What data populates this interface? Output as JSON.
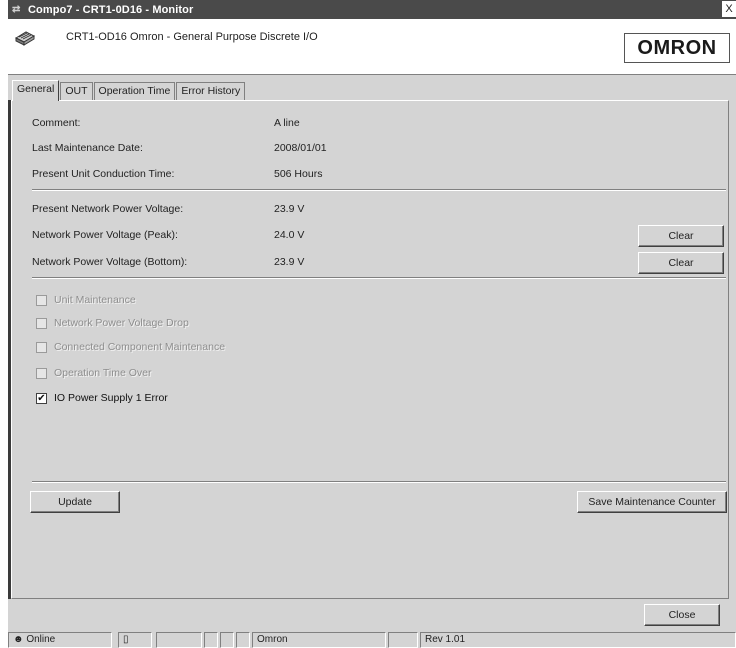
{
  "window": {
    "title": "Compo7 - CRT1-0D16 - Monitor",
    "close_glyph": "X"
  },
  "header": {
    "device_title": "CRT1-OD16   Omron - General Purpose Discrete I/O",
    "logo_text": "OMRON"
  },
  "tabs": [
    {
      "label": "General",
      "active": true
    },
    {
      "label": "OUT",
      "active": false
    },
    {
      "label": "Operation Time",
      "active": false
    },
    {
      "label": "Error History",
      "active": false
    }
  ],
  "general": {
    "comment_label": "Comment:",
    "comment_value": "A line",
    "last_maint_label": "Last Maintenance Date:",
    "last_maint_value": "2008/01/01",
    "conduction_label": "Present Unit Conduction Time:",
    "conduction_value": "506 Hours",
    "voltage_label": "Present Network Power Voltage:",
    "voltage_value": "23.9 V",
    "peak_label": "Network Power Voltage (Peak):",
    "peak_value": "24.0 V",
    "bottom_label": "Network Power Voltage (Bottom):",
    "bottom_value": "23.9 V",
    "clear_label": "Clear",
    "checkboxes": [
      {
        "label": "Unit Maintenance",
        "checked": false,
        "enabled": false
      },
      {
        "label": "Network Power Voltage Drop",
        "checked": false,
        "enabled": false
      },
      {
        "label": "Connected Component Maintenance",
        "checked": false,
        "enabled": false
      },
      {
        "label": "Operation Time Over",
        "checked": false,
        "enabled": false
      },
      {
        "label": "IO Power Supply 1 Error",
        "checked": true,
        "enabled": true
      }
    ],
    "update_label": "Update",
    "save_counter_label": "Save Maintenance Counter"
  },
  "close_label": "Close",
  "statusbar": {
    "online": "Online",
    "vendor": "Omron",
    "revision": "Rev 1.01"
  },
  "colors": {
    "title_bg": "#4a4a4a",
    "window_bg": "#d4d4d4",
    "header_bg": "#ffffff"
  }
}
